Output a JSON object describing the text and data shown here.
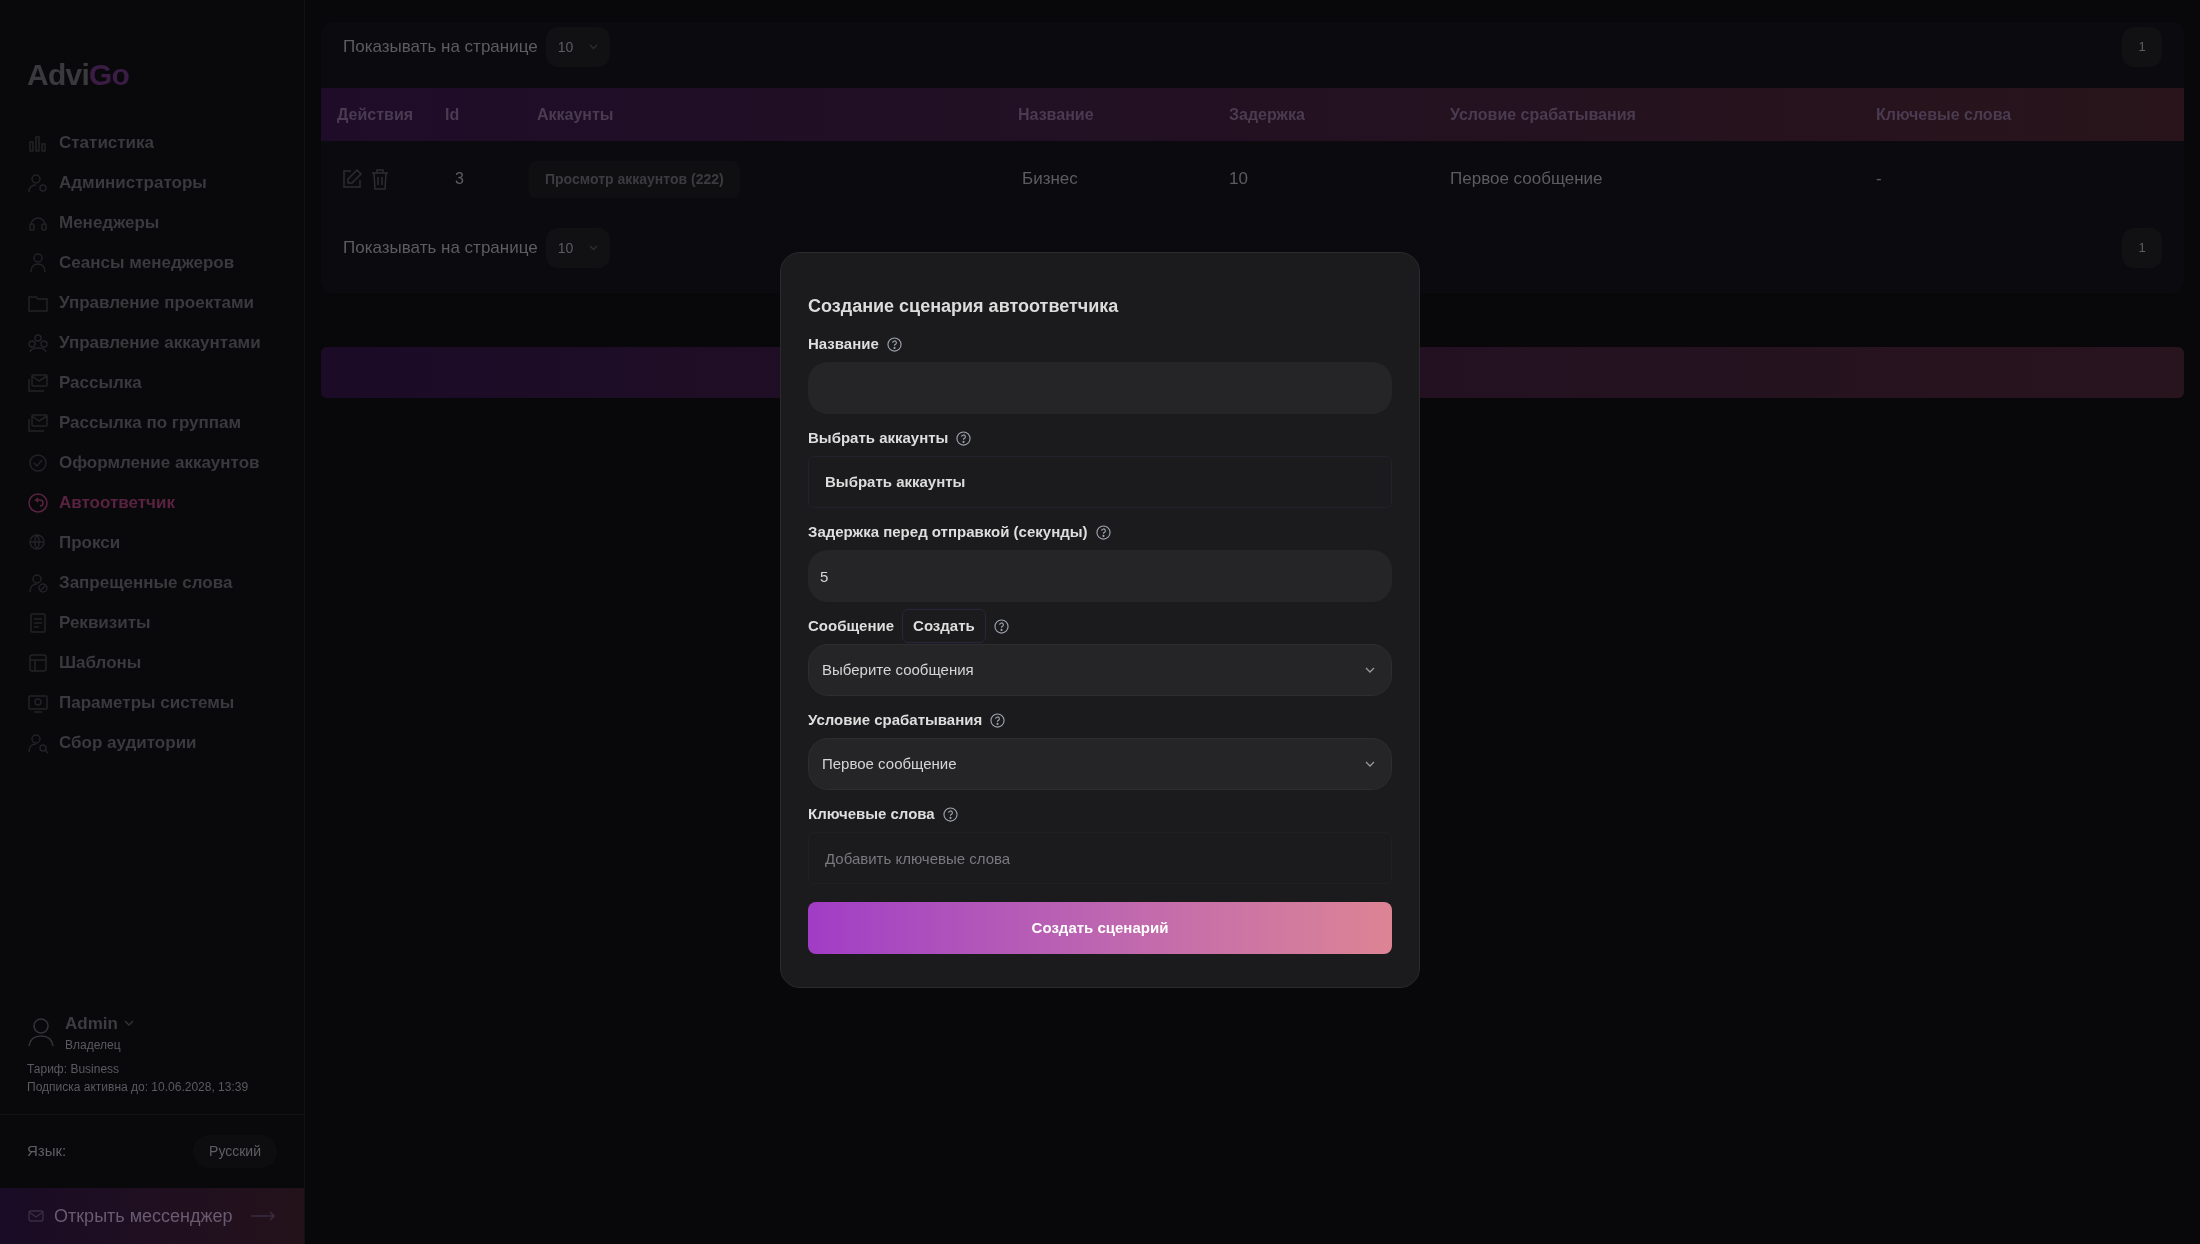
{
  "logo": {
    "main": "Advi",
    "accent": "Go"
  },
  "sidebar": {
    "items": [
      {
        "label": "Статистика",
        "selected": false
      },
      {
        "label": "Администраторы",
        "selected": false
      },
      {
        "label": "Менеджеры",
        "selected": false
      },
      {
        "label": "Сеансы менеджеров",
        "selected": false
      },
      {
        "label": "Управление проектами",
        "selected": false
      },
      {
        "label": "Управление аккаунтами",
        "selected": false
      },
      {
        "label": "Рассылка",
        "selected": false
      },
      {
        "label": "Рассылка по группам",
        "selected": false
      },
      {
        "label": "Оформление аккаунтов",
        "selected": false
      },
      {
        "label": "Автоответчик",
        "selected": true
      },
      {
        "label": "Прокси",
        "selected": false
      },
      {
        "label": "Запрещенные слова",
        "selected": false
      },
      {
        "label": "Реквизиты",
        "selected": false
      },
      {
        "label": "Шаблоны",
        "selected": false
      },
      {
        "label": "Параметры системы",
        "selected": false
      },
      {
        "label": "Сбор аудитории",
        "selected": false
      }
    ]
  },
  "user": {
    "name": "Admin",
    "role": "Владелец",
    "tariff": "Тариф: Business",
    "subscription": "Подписка активна до: 10.06.2028, 13:39"
  },
  "language": {
    "label": "Язык:",
    "value": "Русский"
  },
  "messenger_button": "Открыть мессенджер",
  "pagination_top": {
    "label": "Показывать на странице",
    "per_page": "10",
    "page": "1"
  },
  "table": {
    "columns": [
      "Действия",
      "Id",
      "Аккаунты",
      "Название",
      "Задержка",
      "Условие срабатывания",
      "Ключевые слова"
    ],
    "rows": [
      {
        "id": "3",
        "accounts": "Просмотр аккаунтов (222)",
        "name": "Бизнес",
        "delay": "10",
        "condition": "Первое сообщение",
        "keywords": "-"
      }
    ]
  },
  "pagination_bottom": {
    "label": "Показывать на странице",
    "per_page": "10",
    "page": "1"
  },
  "modal": {
    "title": "Создание сценария автоответчика",
    "fields": [
      {
        "kind": "text",
        "label": "Название"
      },
      {
        "kind": "picker",
        "label": "Выбрать аккаунты",
        "text": "Выбрать аккаунты"
      },
      {
        "kind": "text",
        "label": "Задержка перед отправкой (секунды)",
        "value": "5"
      },
      {
        "kind": "select",
        "label": "Сообщение",
        "action": "Создать",
        "text": "Выберите сообщения"
      },
      {
        "kind": "select",
        "label": "Условие срабатывания",
        "text": "Первое сообщение"
      },
      {
        "kind": "tags",
        "label": "Ключевые слова",
        "placeholder": "Добавить ключевые слова"
      }
    ],
    "submit": "Создать сценарий"
  }
}
